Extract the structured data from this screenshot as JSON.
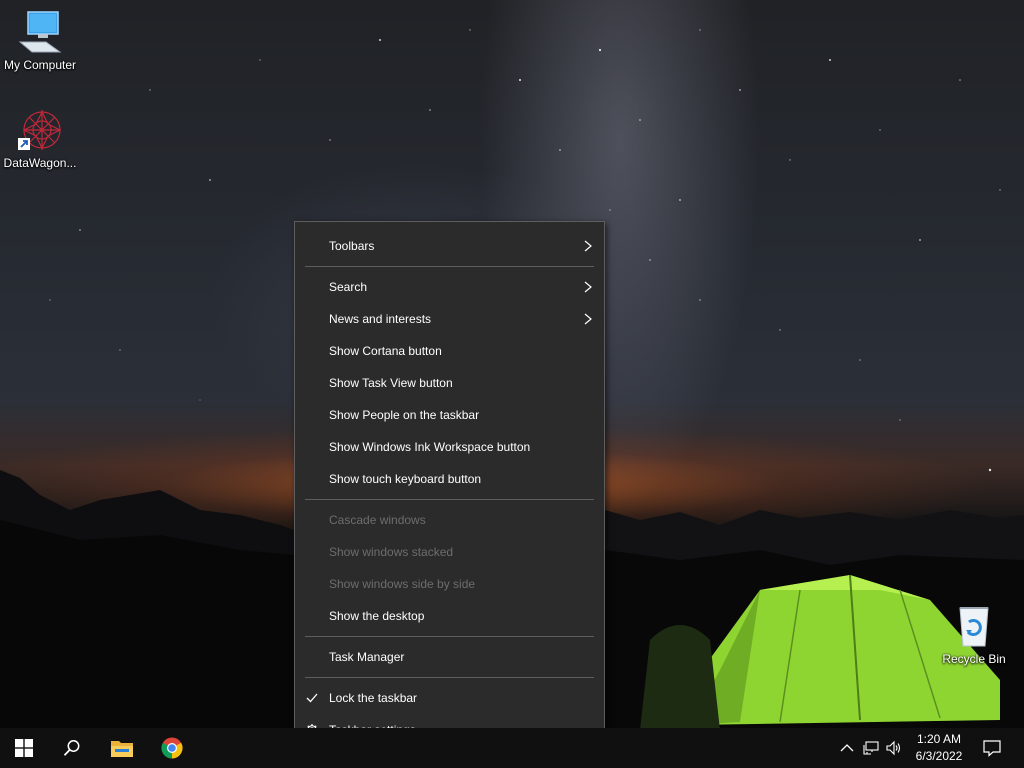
{
  "desktop": {
    "icons": [
      {
        "label": "My Computer",
        "icon": "computer-icon"
      },
      {
        "label": "DataWagon...",
        "icon": "datawagon-app-icon"
      },
      {
        "label": "Recycle Bin",
        "icon": "recycle-bin-icon"
      }
    ]
  },
  "context_menu": {
    "items": [
      {
        "label": "Toolbars",
        "has_submenu": true
      },
      {
        "label": "Search",
        "has_submenu": true
      },
      {
        "label": "News and interests",
        "has_submenu": true
      },
      {
        "label": "Show Cortana button"
      },
      {
        "label": "Show Task View button"
      },
      {
        "label": "Show People on the taskbar"
      },
      {
        "label": "Show Windows Ink Workspace button"
      },
      {
        "label": "Show touch keyboard button"
      },
      {
        "label": "Cascade windows",
        "disabled": true
      },
      {
        "label": "Show windows stacked",
        "disabled": true
      },
      {
        "label": "Show windows side by side",
        "disabled": true
      },
      {
        "label": "Show the desktop"
      },
      {
        "label": "Task Manager"
      },
      {
        "label": "Lock the taskbar",
        "checked": true,
        "icon": "checkmark-icon"
      },
      {
        "label": "Taskbar settings",
        "icon": "gear-icon"
      }
    ]
  },
  "taskbar": {
    "pinned": [
      {
        "name": "start-button",
        "icon": "windows-logo-icon"
      },
      {
        "name": "search-button",
        "icon": "search-icon"
      },
      {
        "name": "file-explorer-button",
        "icon": "folder-icon"
      },
      {
        "name": "chrome-button",
        "icon": "chrome-icon"
      }
    ],
    "tray": {
      "icons": [
        "chevron-up-icon",
        "network-icon",
        "volume-icon"
      ],
      "time": "1:20 AM",
      "date": "6/3/2022",
      "notification_icon": "notification-icon"
    }
  },
  "colors": {
    "menu_bg": "#2b2b2b",
    "menu_border": "#5e5e5e",
    "disabled_text": "#6d6d6d",
    "taskbar_bg": "#101010",
    "tent_green": "#9be23a"
  }
}
